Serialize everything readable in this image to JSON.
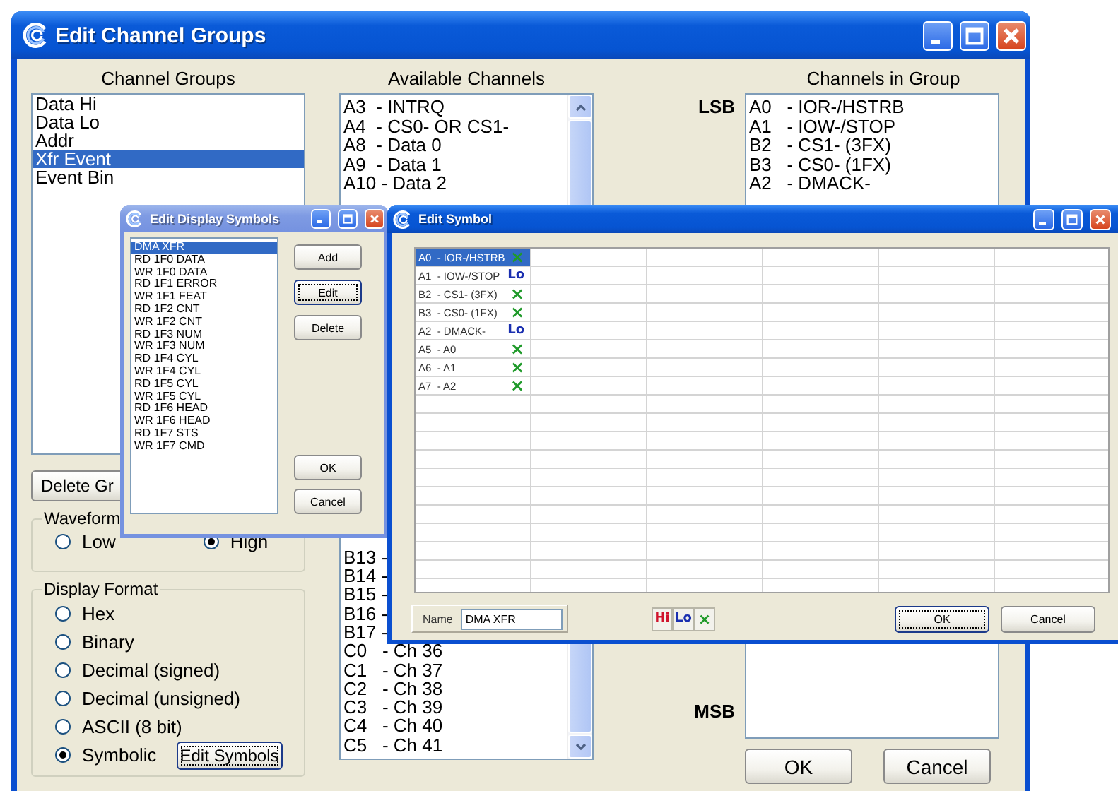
{
  "main_window": {
    "title": "Edit Channel Groups",
    "channel_groups": {
      "label": "Channel Groups",
      "items": [
        {
          "text": "Data Hi",
          "selected": false
        },
        {
          "text": "Data Lo",
          "selected": false
        },
        {
          "text": "Addr",
          "selected": false
        },
        {
          "text": "Xfr Event",
          "selected": true
        },
        {
          "text": "Event Bin",
          "selected": false
        }
      ]
    },
    "delete_group_button": "Delete Gr",
    "waveform": {
      "label": "Waveform",
      "options": [
        {
          "label": "Low",
          "selected": false
        },
        {
          "label": "High",
          "selected": true
        }
      ]
    },
    "display_format": {
      "label": "Display Format",
      "options": [
        {
          "label": "Hex",
          "selected": false
        },
        {
          "label": "Binary",
          "selected": false
        },
        {
          "label": "Decimal (signed)",
          "selected": false
        },
        {
          "label": "Decimal (unsigned)",
          "selected": false
        },
        {
          "label": "ASCII (8 bit)",
          "selected": false
        },
        {
          "label": "Symbolic",
          "selected": true
        }
      ],
      "edit_symbols_button": {
        "label": "Edit Symbols",
        "focused": true
      }
    },
    "available_channels": {
      "label": "Available Channels",
      "items_top": [
        "A3  - INTRQ",
        "A4  - CS0- OR CS1-",
        "A8  - Data 0",
        "A9  - Data 1",
        "A10 - Data 2"
      ],
      "items_bottom": [
        "B13 -",
        "B14 -",
        "B15 -",
        "B16 -",
        "B17 -",
        "C0   - Ch 36",
        "C1   - Ch 37",
        "C2   - Ch 38",
        "C3   - Ch 39",
        "C4   - Ch 40",
        "C5   - Ch 41"
      ]
    },
    "channels_in_group": {
      "label": "Channels in Group",
      "lsb_label": "LSB",
      "msb_label": "MSB",
      "items": [
        "A0   - IOR-/HSTRB",
        "A1   - IOW-/STOP",
        "B2   - CS1- (3FX)",
        "B3   - CS0- (1FX)",
        "A2   - DMACK-"
      ]
    },
    "buttons": [
      "OK",
      "Cancel"
    ]
  },
  "display_symbols_window": {
    "title": "Edit Display Symbols",
    "symbols": [
      {
        "text": "DMA XFR",
        "selected": true
      },
      {
        "text": "RD 1F0 DATA",
        "selected": false
      },
      {
        "text": "WR 1F0 DATA",
        "selected": false
      },
      {
        "text": "RD 1F1 ERROR",
        "selected": false
      },
      {
        "text": "WR 1F1 FEAT",
        "selected": false
      },
      {
        "text": "RD 1F2 CNT",
        "selected": false
      },
      {
        "text": "WR 1F2 CNT",
        "selected": false
      },
      {
        "text": "RD 1F3 NUM",
        "selected": false
      },
      {
        "text": "WR 1F3 NUM",
        "selected": false
      },
      {
        "text": "RD 1F4 CYL",
        "selected": false
      },
      {
        "text": "WR 1F4 CYL",
        "selected": false
      },
      {
        "text": "RD 1F5 CYL",
        "selected": false
      },
      {
        "text": "WR 1F5 CYL",
        "selected": false
      },
      {
        "text": "RD 1F6 HEAD",
        "selected": false
      },
      {
        "text": "WR 1F6 HEAD",
        "selected": false
      },
      {
        "text": "RD 1F7 STS",
        "selected": false
      },
      {
        "text": "WR 1F7 CMD",
        "selected": false
      }
    ],
    "buttons": [
      {
        "label": "Add",
        "focused": false
      },
      {
        "label": "Edit",
        "focused": true
      },
      {
        "label": "Delete",
        "focused": false
      }
    ],
    "dialog_buttons": [
      "OK",
      "Cancel"
    ]
  },
  "symbol_window": {
    "title": "Edit Symbol",
    "rows": [
      {
        "channel": "A0  - IOR-/HSTRB",
        "mark": "×",
        "kind": "x",
        "selected": true
      },
      {
        "channel": "A1  - IOW-/STOP",
        "mark": "Lo",
        "kind": "lo",
        "selected": false
      },
      {
        "channel": "B2  - CS1- (3FX)",
        "mark": "×",
        "kind": "x",
        "selected": false
      },
      {
        "channel": "B3  - CS0- (1FX)",
        "mark": "×",
        "kind": "x",
        "selected": false
      },
      {
        "channel": "A2  - DMACK-",
        "mark": "Lo",
        "kind": "lo",
        "selected": false
      },
      {
        "channel": "A5  - A0",
        "mark": "×",
        "kind": "x",
        "selected": false
      },
      {
        "channel": "A6  - A1",
        "mark": "×",
        "kind": "x",
        "selected": false
      },
      {
        "channel": "A7  - A2",
        "mark": "×",
        "kind": "x",
        "selected": false
      }
    ],
    "name_label": "Name",
    "name_value": "DMA XFR",
    "state_buttons": [
      {
        "kind": "hi",
        "label": "Hi"
      },
      {
        "kind": "lo",
        "label": "Lo"
      },
      {
        "kind": "x",
        "label": "×"
      }
    ],
    "buttons": [
      {
        "label": "OK",
        "focused": true
      },
      {
        "label": "Cancel",
        "focused": false
      }
    ]
  }
}
